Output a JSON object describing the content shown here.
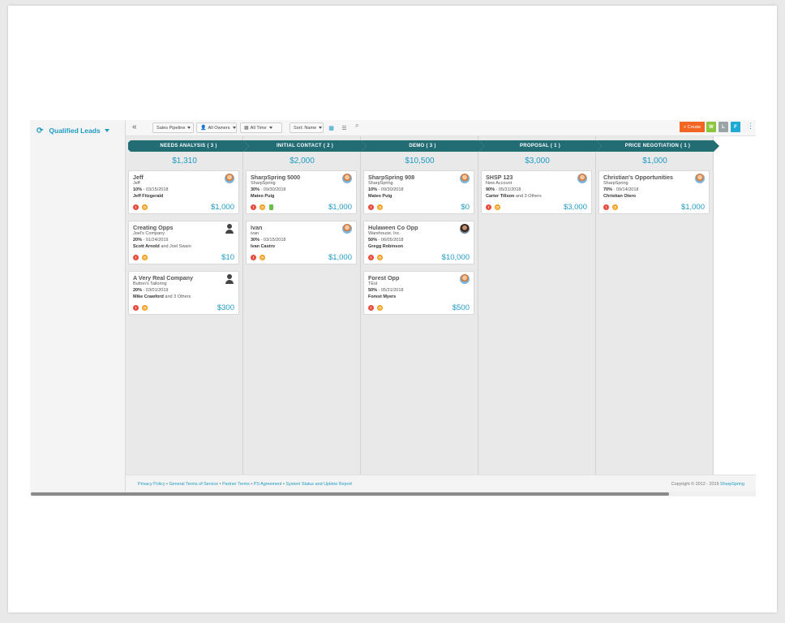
{
  "sidebar": {
    "title": "Qualified Leads"
  },
  "toolbar": {
    "pipeline": "Sales Pipeline",
    "owners": "All Owners",
    "time": "All Time",
    "sort": "Sort: Name",
    "create": "+ Create",
    "w": "W",
    "l": "L",
    "f": "F"
  },
  "colors": {
    "accent": "#1e9bc3",
    "stage": "#226c74",
    "create": "#f26522",
    "w": "#8cc63f",
    "l": "#9aa4a6",
    "f": "#1eaad3"
  },
  "columns": [
    {
      "stage": "NEEDS ANALYSIS ( 3 )",
      "total": "$1,310",
      "cards": [
        {
          "title": "Jeff",
          "company": "Jeff",
          "pct": "10%",
          "date": " - 03/15/2018",
          "owner": "Jeff Fitzgerald",
          "others": "",
          "amount": "$1,000",
          "avatar": "face",
          "doc": false
        },
        {
          "title": "Creating Opps",
          "company": "Joel's Company",
          "pct": "20%",
          "date": " - 01/24/2019",
          "owner": "Scott Arnold",
          "others": " and Joel Swain",
          "amount": "$10",
          "avatar": "generic",
          "doc": false
        },
        {
          "title": "A Very Real Company",
          "company": "Button's Tailoring",
          "pct": "20%",
          "date": " - 03/01/2019",
          "owner": "Mike Crawford",
          "others": " and 3 Others",
          "amount": "$300",
          "avatar": "generic",
          "doc": false
        }
      ]
    },
    {
      "stage": "INITIAL CONTACT ( 2 )",
      "total": "$2,000",
      "cards": [
        {
          "title": "SharpSpring 5000",
          "company": "SharpSpring",
          "pct": "30%",
          "date": " - 09/30/2018",
          "owner": "Mateo Puig",
          "others": "",
          "amount": "$1,000",
          "avatar": "face",
          "doc": true
        },
        {
          "title": "Ivan",
          "company": "ivan",
          "pct": "30%",
          "date": " - 03/15/2018",
          "owner": "Ivan Castro",
          "others": "",
          "amount": "$1,000",
          "avatar": "face",
          "doc": false
        }
      ]
    },
    {
      "stage": "DEMO ( 3 )",
      "total": "$10,500",
      "cards": [
        {
          "title": "SharpSpring 908",
          "company": "SharpSpring",
          "pct": "10%",
          "date": " - 09/30/2018",
          "owner": "Mateo Puig",
          "others": "",
          "amount": "$0",
          "avatar": "face",
          "doc": false
        },
        {
          "title": "Hulaween Co Opp",
          "company": "Warehouse, Inc.",
          "pct": "50%",
          "date": " - 06/05/2018",
          "owner": "Gregg Robinson",
          "others": "",
          "amount": "$10,000",
          "avatar": "dark",
          "doc": false
        },
        {
          "title": "Forest Opp",
          "company": "TEst",
          "pct": "50%",
          "date": " - 05/31/2018",
          "owner": "Forest Myers",
          "others": "",
          "amount": "$500",
          "avatar": "face",
          "doc": false
        }
      ]
    },
    {
      "stage": "PROPOSAL ( 1 )",
      "total": "$3,000",
      "cards": [
        {
          "title": "SHSP 123",
          "company": "New Account",
          "pct": "90%",
          "date": " - 05/31/2018",
          "owner": "Carter Tillson",
          "others": " and 3 Others",
          "amount": "$3,000",
          "avatar": "face",
          "doc": false
        }
      ]
    },
    {
      "stage": "PRICE NEGOTIATION ( 1 )",
      "total": "$1,000",
      "cards": [
        {
          "title": "Christian's Opportunities",
          "company": "SharpSpring",
          "pct": "70%",
          "date": " - 09/14/2018",
          "owner": "Christian Otero",
          "others": "",
          "amount": "$1,000",
          "avatar": "face",
          "doc": false
        }
      ]
    }
  ],
  "footer": {
    "links": [
      "Privacy Policy",
      "General Terms of Service",
      "Partner Terms",
      "PS Agreement",
      "System Status and Uptime Report"
    ],
    "separator": " • ",
    "copyright": "Copyright © 2012 - 2019 ",
    "brand": "SharpSpring"
  }
}
